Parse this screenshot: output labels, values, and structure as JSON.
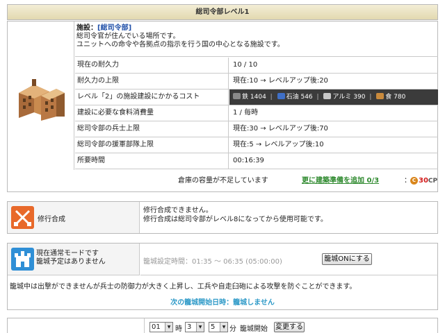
{
  "title": "総司令部レベル1",
  "facility": {
    "name_label": "施設：",
    "name": "[総司令部]",
    "desc1": "総司令官が住んでいる場所です。",
    "desc2": "ユニットへの命令や各拠点の指示を行う国の中心となる施設です。",
    "stats": [
      {
        "label": "現在の耐久力",
        "value": "10 / 10"
      },
      {
        "label": "耐久力の上限",
        "value": "現在:10 → レベルアップ後:20"
      },
      {
        "label": "レベル「2」の施設建設にかかるコスト",
        "value": ""
      },
      {
        "label": "建設に必要な食料消費量",
        "value": "1 / 毎時"
      },
      {
        "label": "総司令部の兵士上限",
        "value": "現在:30 → レベルアップ後:70"
      },
      {
        "label": "総司令部の援軍部隊上限",
        "value": "現在:5 → レベルアップ後:10"
      },
      {
        "label": "所要時間",
        "value": "00:16:39"
      }
    ],
    "cost": {
      "iron_label": "鉄",
      "iron": "1404",
      "oil_label": "石油",
      "oil": "546",
      "alum_label": "アルミ",
      "alum": "390",
      "food_label": "食",
      "food": "780",
      "separator": "|"
    },
    "warning": "倉庫の容量が不足しています",
    "upgrade_link": "更に建築準備を追加 0/3",
    "cp_colon": "：",
    "cp_icon": "C",
    "cp_value": "30",
    "cp_unit": "CP"
  },
  "training": {
    "title": "修行合成",
    "line1": "修行合成できません。",
    "line2": "修行合成は総司令部がレベル8になってから使用可能です。"
  },
  "siege": {
    "status1": "現在通常モードです",
    "status2": "籠城予定はありません",
    "time_label": "籠城設定時間：",
    "time_value": "01:35 〜 06:35 (05:00:00)",
    "button": "籠城ONにする",
    "info": "籠城中は出撃ができませんが兵士の防御力が大きく上昇し、工兵や自走臼砲による攻撃を防ぐことができます。",
    "next": "次の籠城開始日時：籠城しません"
  },
  "schedule": {
    "hour": "01",
    "hour_label": "時",
    "min_tens": "3",
    "min_ones": "5",
    "min_label": "分",
    "start_label": "籠城開始",
    "button": "変更する",
    "arrow": "▼"
  },
  "colors": {
    "link_green": "#2f8a2f",
    "cp_red": "#d21c1c",
    "next_blue": "#2f9ac8",
    "training_icon": "#e8692a",
    "siege_icon": "#2f8fd6"
  }
}
